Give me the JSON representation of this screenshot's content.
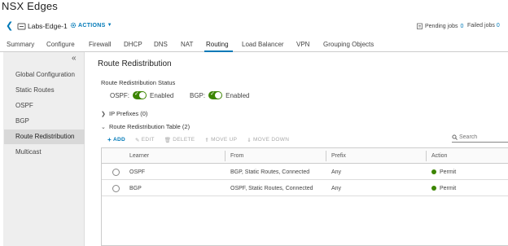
{
  "app": {
    "title": "NSX Edges"
  },
  "header": {
    "edge_name": "Labs-Edge-1",
    "actions_label": "ACTIONS",
    "pending_label": "Pending jobs",
    "pending_count": "0",
    "failed_label": "Failed jobs",
    "failed_count": "0"
  },
  "tabs": [
    {
      "label": "Summary"
    },
    {
      "label": "Configure"
    },
    {
      "label": "Firewall"
    },
    {
      "label": "DHCP"
    },
    {
      "label": "DNS"
    },
    {
      "label": "NAT"
    },
    {
      "label": "Routing",
      "active": true
    },
    {
      "label": "Load Balancer"
    },
    {
      "label": "VPN"
    },
    {
      "label": "Grouping Objects"
    }
  ],
  "sidebar": {
    "items": [
      {
        "label": "Global Configuration"
      },
      {
        "label": "Static Routes"
      },
      {
        "label": "OSPF"
      },
      {
        "label": "BGP"
      },
      {
        "label": "Route Redistribution",
        "selected": true
      },
      {
        "label": "Multicast"
      }
    ]
  },
  "main": {
    "title": "Route Redistribution",
    "status_label": "Route Redistribution Status",
    "ospf_label": "OSPF:",
    "ospf_state": "Enabled",
    "bgp_label": "BGP:",
    "bgp_state": "Enabled",
    "ip_prefixes_label": "IP Prefixes (0)",
    "table_label": "Route Redistribution Table (2)"
  },
  "toolbar": {
    "add": "ADD",
    "edit": "EDIT",
    "delete": "DELETE",
    "move_up": "MOVE UP",
    "move_down": "MOVE DOWN",
    "search_placeholder": "Search"
  },
  "table": {
    "columns": [
      "Learner",
      "From",
      "Prefix",
      "Action"
    ],
    "rows": [
      {
        "learner": "OSPF",
        "from": "BGP, Static Routes, Connected",
        "prefix": "Any",
        "action": "Permit"
      },
      {
        "learner": "BGP",
        "from": "OSPF, Static Routes, Connected",
        "prefix": "Any",
        "action": "Permit"
      }
    ]
  },
  "colors": {
    "accent": "#0079b8",
    "toggle_on": "#3c8500",
    "permit": "#3c8500"
  }
}
